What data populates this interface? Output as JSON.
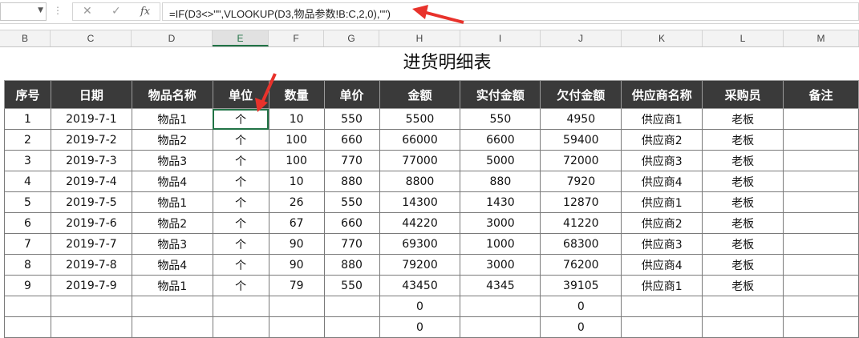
{
  "formula_bar": {
    "name_box": "",
    "cancel_icon": "✕",
    "enter_icon": "✓",
    "fx_label": "fx",
    "formula": "=IF(D3<>\"\",VLOOKUP(D3,物品参数!B:C,2,0),\"\")"
  },
  "columns": [
    "B",
    "C",
    "D",
    "E",
    "F",
    "G",
    "H",
    "I",
    "J",
    "K",
    "L",
    "M"
  ],
  "sheet": {
    "title": "进货明细表",
    "headers": [
      "序号",
      "日期",
      "物品名称",
      "单位",
      "数量",
      "单价",
      "金额",
      "实付金额",
      "欠付金额",
      "供应商名称",
      "采购员",
      "备注"
    ],
    "rows": [
      [
        "1",
        "2019-7-1",
        "物品1",
        "个",
        "10",
        "550",
        "5500",
        "550",
        "4950",
        "供应商1",
        "老板",
        ""
      ],
      [
        "2",
        "2019-7-2",
        "物品2",
        "个",
        "100",
        "660",
        "66000",
        "6600",
        "59400",
        "供应商2",
        "老板",
        ""
      ],
      [
        "3",
        "2019-7-3",
        "物品3",
        "个",
        "100",
        "770",
        "77000",
        "5000",
        "72000",
        "供应商3",
        "老板",
        ""
      ],
      [
        "4",
        "2019-7-4",
        "物品4",
        "个",
        "10",
        "880",
        "8800",
        "880",
        "7920",
        "供应商4",
        "老板",
        ""
      ],
      [
        "5",
        "2019-7-5",
        "物品1",
        "个",
        "26",
        "550",
        "14300",
        "1430",
        "12870",
        "供应商1",
        "老板",
        ""
      ],
      [
        "6",
        "2019-7-6",
        "物品2",
        "个",
        "67",
        "660",
        "44220",
        "3000",
        "41220",
        "供应商2",
        "老板",
        ""
      ],
      [
        "7",
        "2019-7-7",
        "物品3",
        "个",
        "90",
        "770",
        "69300",
        "1000",
        "68300",
        "供应商3",
        "老板",
        ""
      ],
      [
        "8",
        "2019-7-8",
        "物品4",
        "个",
        "90",
        "880",
        "79200",
        "3000",
        "76200",
        "供应商4",
        "老板",
        ""
      ],
      [
        "9",
        "2019-7-9",
        "物品1",
        "个",
        "79",
        "550",
        "43450",
        "4345",
        "39105",
        "供应商1",
        "老板",
        ""
      ],
      [
        "",
        "",
        "",
        "",
        "",
        "",
        "0",
        "",
        "0",
        "",
        "",
        ""
      ],
      [
        "",
        "",
        "",
        "",
        "",
        "",
        "0",
        "",
        "0",
        "",
        "",
        ""
      ]
    ]
  },
  "colors": {
    "header_bg": "#3a3a3a",
    "selection": "#217346",
    "arrow": "#e8322b"
  }
}
